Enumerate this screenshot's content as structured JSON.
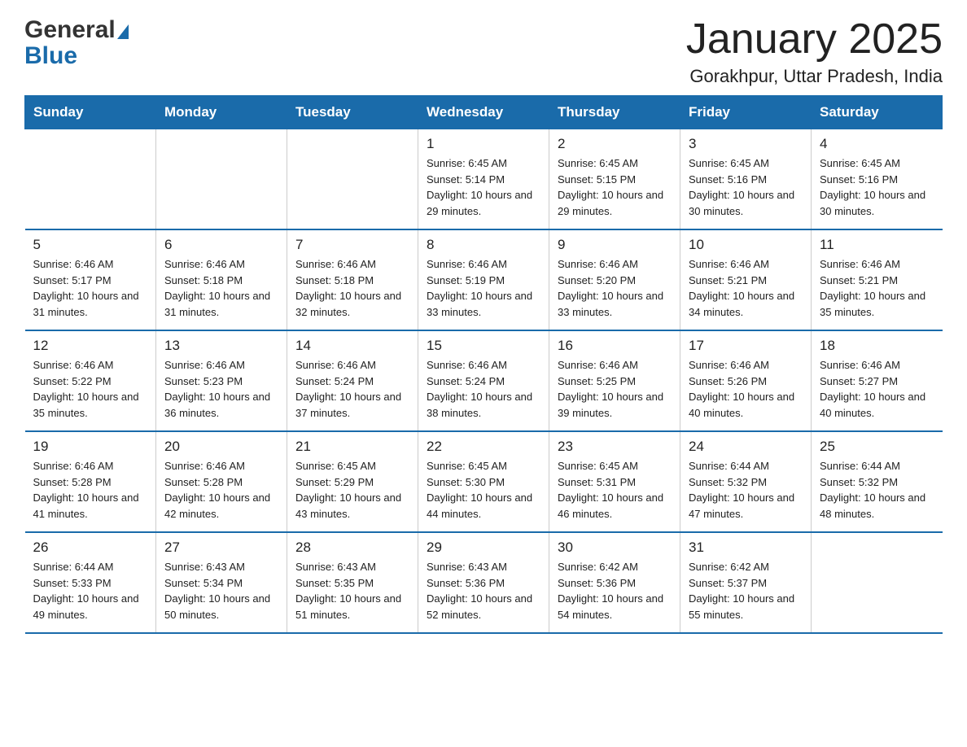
{
  "header": {
    "logo_general": "General",
    "logo_blue": "Blue",
    "title": "January 2025",
    "subtitle": "Gorakhpur, Uttar Pradesh, India"
  },
  "weekdays": [
    "Sunday",
    "Monday",
    "Tuesday",
    "Wednesday",
    "Thursday",
    "Friday",
    "Saturday"
  ],
  "weeks": [
    [
      {
        "day": "",
        "info": ""
      },
      {
        "day": "",
        "info": ""
      },
      {
        "day": "",
        "info": ""
      },
      {
        "day": "1",
        "info": "Sunrise: 6:45 AM\nSunset: 5:14 PM\nDaylight: 10 hours\nand 29 minutes."
      },
      {
        "day": "2",
        "info": "Sunrise: 6:45 AM\nSunset: 5:15 PM\nDaylight: 10 hours\nand 29 minutes."
      },
      {
        "day": "3",
        "info": "Sunrise: 6:45 AM\nSunset: 5:16 PM\nDaylight: 10 hours\nand 30 minutes."
      },
      {
        "day": "4",
        "info": "Sunrise: 6:45 AM\nSunset: 5:16 PM\nDaylight: 10 hours\nand 30 minutes."
      }
    ],
    [
      {
        "day": "5",
        "info": "Sunrise: 6:46 AM\nSunset: 5:17 PM\nDaylight: 10 hours\nand 31 minutes."
      },
      {
        "day": "6",
        "info": "Sunrise: 6:46 AM\nSunset: 5:18 PM\nDaylight: 10 hours\nand 31 minutes."
      },
      {
        "day": "7",
        "info": "Sunrise: 6:46 AM\nSunset: 5:18 PM\nDaylight: 10 hours\nand 32 minutes."
      },
      {
        "day": "8",
        "info": "Sunrise: 6:46 AM\nSunset: 5:19 PM\nDaylight: 10 hours\nand 33 minutes."
      },
      {
        "day": "9",
        "info": "Sunrise: 6:46 AM\nSunset: 5:20 PM\nDaylight: 10 hours\nand 33 minutes."
      },
      {
        "day": "10",
        "info": "Sunrise: 6:46 AM\nSunset: 5:21 PM\nDaylight: 10 hours\nand 34 minutes."
      },
      {
        "day": "11",
        "info": "Sunrise: 6:46 AM\nSunset: 5:21 PM\nDaylight: 10 hours\nand 35 minutes."
      }
    ],
    [
      {
        "day": "12",
        "info": "Sunrise: 6:46 AM\nSunset: 5:22 PM\nDaylight: 10 hours\nand 35 minutes."
      },
      {
        "day": "13",
        "info": "Sunrise: 6:46 AM\nSunset: 5:23 PM\nDaylight: 10 hours\nand 36 minutes."
      },
      {
        "day": "14",
        "info": "Sunrise: 6:46 AM\nSunset: 5:24 PM\nDaylight: 10 hours\nand 37 minutes."
      },
      {
        "day": "15",
        "info": "Sunrise: 6:46 AM\nSunset: 5:24 PM\nDaylight: 10 hours\nand 38 minutes."
      },
      {
        "day": "16",
        "info": "Sunrise: 6:46 AM\nSunset: 5:25 PM\nDaylight: 10 hours\nand 39 minutes."
      },
      {
        "day": "17",
        "info": "Sunrise: 6:46 AM\nSunset: 5:26 PM\nDaylight: 10 hours\nand 40 minutes."
      },
      {
        "day": "18",
        "info": "Sunrise: 6:46 AM\nSunset: 5:27 PM\nDaylight: 10 hours\nand 40 minutes."
      }
    ],
    [
      {
        "day": "19",
        "info": "Sunrise: 6:46 AM\nSunset: 5:28 PM\nDaylight: 10 hours\nand 41 minutes."
      },
      {
        "day": "20",
        "info": "Sunrise: 6:46 AM\nSunset: 5:28 PM\nDaylight: 10 hours\nand 42 minutes."
      },
      {
        "day": "21",
        "info": "Sunrise: 6:45 AM\nSunset: 5:29 PM\nDaylight: 10 hours\nand 43 minutes."
      },
      {
        "day": "22",
        "info": "Sunrise: 6:45 AM\nSunset: 5:30 PM\nDaylight: 10 hours\nand 44 minutes."
      },
      {
        "day": "23",
        "info": "Sunrise: 6:45 AM\nSunset: 5:31 PM\nDaylight: 10 hours\nand 46 minutes."
      },
      {
        "day": "24",
        "info": "Sunrise: 6:44 AM\nSunset: 5:32 PM\nDaylight: 10 hours\nand 47 minutes."
      },
      {
        "day": "25",
        "info": "Sunrise: 6:44 AM\nSunset: 5:32 PM\nDaylight: 10 hours\nand 48 minutes."
      }
    ],
    [
      {
        "day": "26",
        "info": "Sunrise: 6:44 AM\nSunset: 5:33 PM\nDaylight: 10 hours\nand 49 minutes."
      },
      {
        "day": "27",
        "info": "Sunrise: 6:43 AM\nSunset: 5:34 PM\nDaylight: 10 hours\nand 50 minutes."
      },
      {
        "day": "28",
        "info": "Sunrise: 6:43 AM\nSunset: 5:35 PM\nDaylight: 10 hours\nand 51 minutes."
      },
      {
        "day": "29",
        "info": "Sunrise: 6:43 AM\nSunset: 5:36 PM\nDaylight: 10 hours\nand 52 minutes."
      },
      {
        "day": "30",
        "info": "Sunrise: 6:42 AM\nSunset: 5:36 PM\nDaylight: 10 hours\nand 54 minutes."
      },
      {
        "day": "31",
        "info": "Sunrise: 6:42 AM\nSunset: 5:37 PM\nDaylight: 10 hours\nand 55 minutes."
      },
      {
        "day": "",
        "info": ""
      }
    ]
  ]
}
